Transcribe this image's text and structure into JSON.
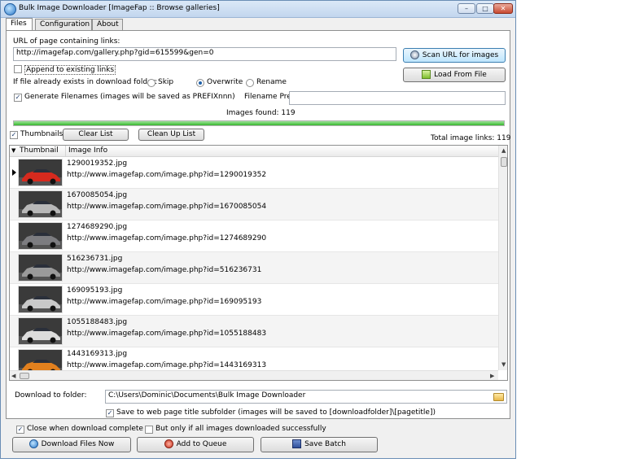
{
  "window": {
    "title": "Bulk Image Downloader [ImageFap :: Browse galleries]",
    "controls": {
      "minimize": "–",
      "maximize": "□",
      "close": "✕"
    }
  },
  "tabs": [
    {
      "label": "Files",
      "active": true
    },
    {
      "label": "Configuration",
      "active": false
    },
    {
      "label": "About",
      "active": false
    }
  ],
  "files": {
    "url_label": "URL of page containing links:",
    "url_value": "http://imagefap.com/gallery.php?gid=615599&gen=0",
    "scan_button": "Scan URL for images",
    "load_button": "Load From File",
    "append_label": "Append to existing links",
    "append_checked": false,
    "exists_label": "If file already exists in download folder:",
    "options": [
      {
        "label": "Skip",
        "selected": false
      },
      {
        "label": "Overwrite",
        "selected": true
      },
      {
        "label": "Rename",
        "selected": false
      }
    ],
    "generate_label": "Generate Filenames (images will be saved as PREFIXnnn)",
    "generate_checked": true,
    "prefix_label": "Filename Prefix:",
    "prefix_value": "",
    "images_found": "Images found: 119",
    "progress_fraction": 1.0,
    "progress_color": "#37b52e",
    "thumbnails_label": "Thumbnails",
    "thumbnails_checked": true,
    "clear_list": "Clear List",
    "clean_up_list": "Clean Up List",
    "total_links": "Total image links: 119"
  },
  "grid": {
    "columns": [
      "Thumbnail",
      "Image Info"
    ],
    "rows": [
      {
        "file": "1290019352.jpg",
        "url": "http://www.imagefap.com/image.php?id=1290019352",
        "car_color": "#d62a1e"
      },
      {
        "file": "1670085054.jpg",
        "url": "http://www.imagefap.com/image.php?id=1670085054",
        "car_color": "#b8b8b8"
      },
      {
        "file": "1274689290.jpg",
        "url": "http://www.imagefap.com/image.php?id=1274689290",
        "car_color": "#7c7c80"
      },
      {
        "file": "516236731.jpg",
        "url": "http://www.imagefap.com/image.php?id=516236731",
        "car_color": "#9a9a9a"
      },
      {
        "file": "169095193.jpg",
        "url": "http://www.imagefap.com/image.php?id=169095193",
        "car_color": "#c9c9c9"
      },
      {
        "file": "1055188483.jpg",
        "url": "http://www.imagefap.com/image.php?id=1055188483",
        "car_color": "#dcdcdc"
      },
      {
        "file": "1443169313.jpg",
        "url": "http://www.imagefap.com/image.php?id=1443169313",
        "car_color": "#e2801e"
      }
    ]
  },
  "download": {
    "folder_label": "Download to folder:",
    "folder_value": "C:\\Users\\Dominic\\Documents\\Bulk Image Downloader",
    "subfolder_label": "Save to web page title subfolder (images will be saved to [downloadfolder]\\[pagetitle])",
    "subfolder_checked": true
  },
  "footer": {
    "close_label": "Close when download complete",
    "close_checked": true,
    "only_if_label": "But only if all images downloaded successfully",
    "only_if_checked": false,
    "download_now": "Download Files Now",
    "add_queue": "Add to Queue",
    "save_batch": "Save Batch"
  }
}
